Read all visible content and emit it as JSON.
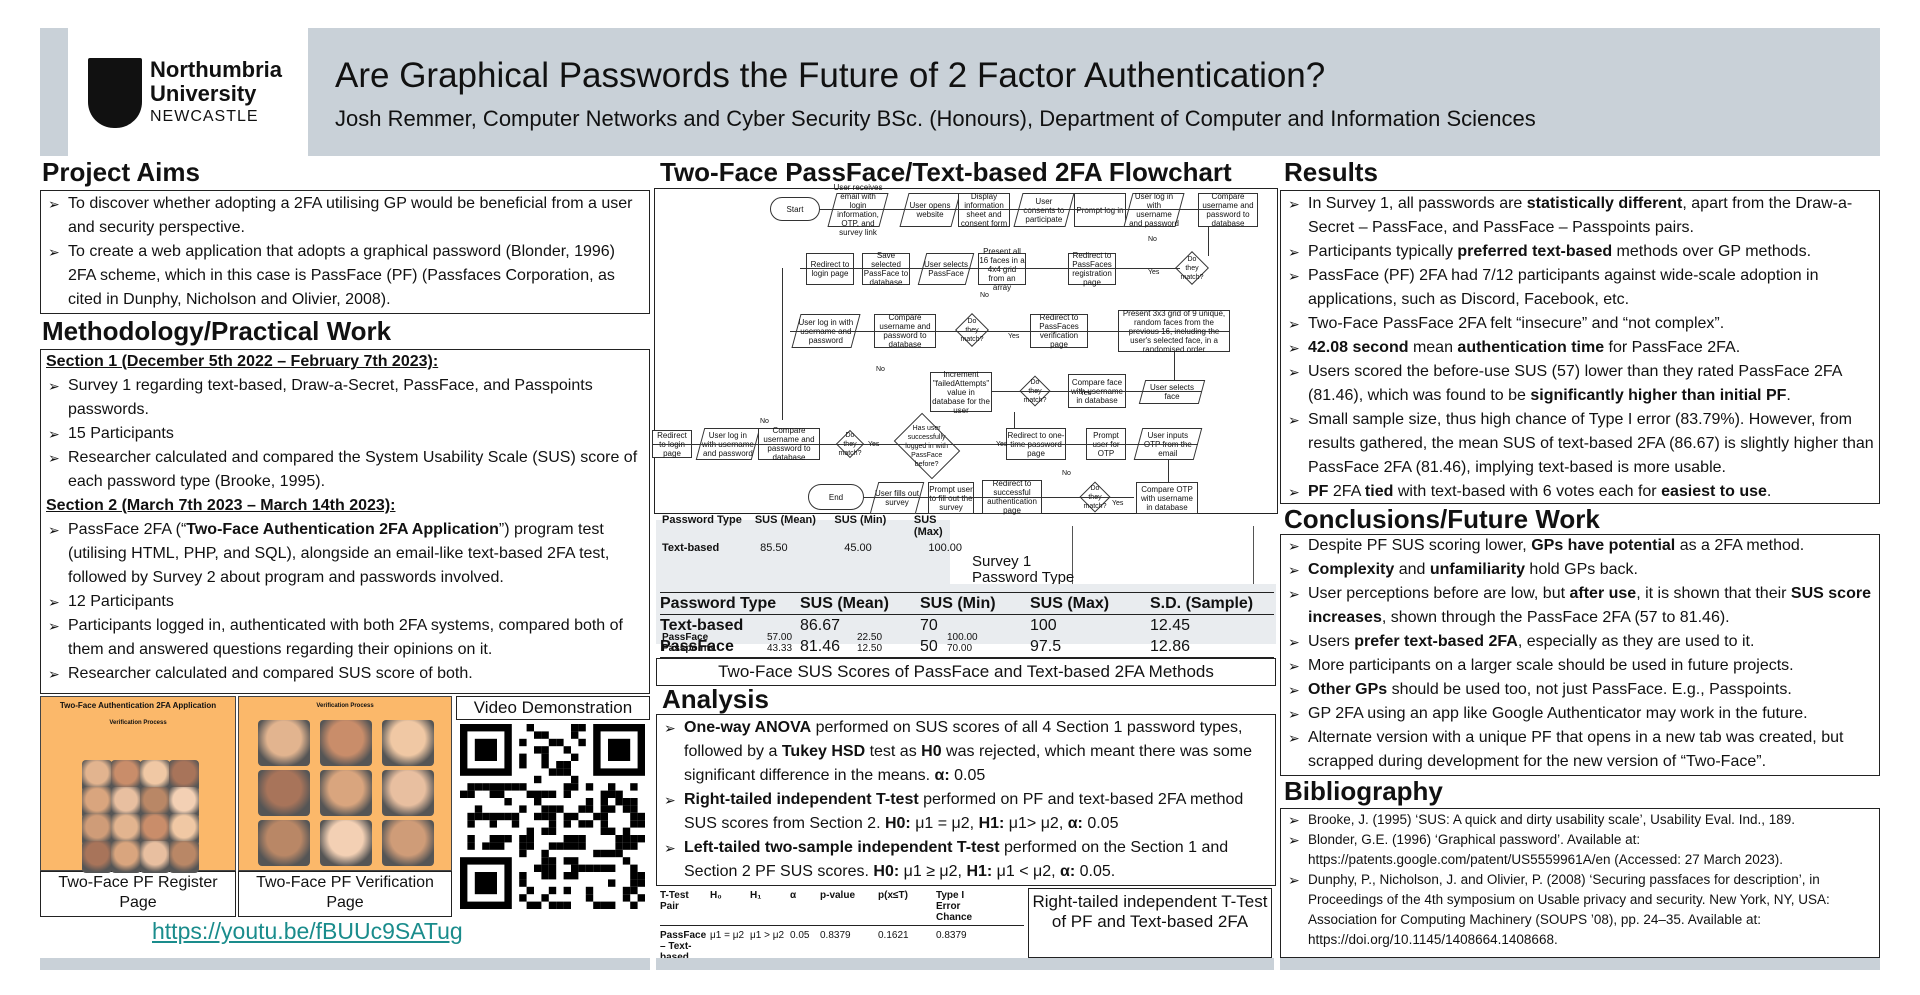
{
  "header": {
    "uni_line1": "Northumbria",
    "uni_line2": "University",
    "uni_line3": "NEWCASTLE",
    "title": "Are Graphical Passwords the Future of 2 Factor Authentication?",
    "subtitle": "Josh Remmer, Computer Networks and Cyber Security BSc. (Honours), Department of Computer and Information Sciences"
  },
  "aims": {
    "heading": "Project Aims",
    "items": [
      "To discover whether adopting a 2FA utilising GP would be beneficial from a user and security perspective.",
      "To create a web application that adopts a graphical password (Blonder, 1996) 2FA scheme, which in this case is PassFace (PF) (Passfaces Corporation, as cited in Dunphy, Nicholson and Olivier, 2008)."
    ]
  },
  "method": {
    "heading": "Methodology/Practical Work",
    "s1_title": "Section 1 (December 5th 2022 – February 7th 2023):",
    "s1_items": [
      "Survey 1 regarding text-based, Draw-a-Secret, PassFace, and Passpoints passwords.",
      "15 Participants",
      "Researcher calculated and compared the System Usability Scale (SUS) score of each password type (Brooke, 1995)."
    ],
    "s2_title": "Section 2 (March 7th 2023 – March 14th 2023):",
    "s2_item1_pre": "PassFace 2FA (“",
    "s2_item1_bold": "Two-Face Authentication 2FA Application",
    "s2_item1_post": "”) program test (utilising HTML, PHP, and SQL), alongside an email-like text-based 2FA test, followed by Survey 2 about program and passwords involved.",
    "s2_items": [
      "12 Participants",
      "Participants logged in, authenticated with both 2FA systems, compared both of them and answered questions regarding their opinions on it.",
      "Researcher calculated and compared SUS score of both."
    ]
  },
  "media": {
    "shot1_title": "Two-Face Authentication 2FA Application",
    "shot1_sub": "Verification Process",
    "shot2_sub": "Verification Process",
    "cap1": "Two-Face PF Register Page",
    "cap2": "Two-Face PF Verification Page",
    "video_label": "Video Demonstration",
    "link": "https://youtu.be/fBUUc9SATug"
  },
  "flow": {
    "heading": "Two-Face PassFace/Text-based 2FA Flowchart",
    "start": "Start",
    "end": "End",
    "r1": [
      "User receives email with login information, OTP, and survey link",
      "User opens website",
      "Display information sheet and consent form",
      "User consents to participate",
      "Prompt log in",
      "User log in with username and password",
      "Compare username and password to database"
    ],
    "r2": [
      "Redirect to login page",
      "Save selected PassFace to database",
      "User selects PassFace",
      "Present all 16 faces in a 4x4 grid from an array",
      "Redirect to PassFaces registration page",
      "Do they match?"
    ],
    "r3": [
      "User log in with username and password",
      "Compare username and password to database",
      "Do they match?",
      "Redirect to PassFaces verification page",
      "Present 3x3 grid of 9 unique, random faces from the previous 16, including the user's selected face, in a randomised order"
    ],
    "r4": [
      "Increment \"failedAttempts\" value in database for the user",
      "Do they match?",
      "Compare face with username in database",
      "User selects face"
    ],
    "r5": [
      "Redirect to login page",
      "User log in with username and password",
      "Compare username and password to database",
      "Do they match?",
      "Has user successfully logged in with PassFace before?",
      "Redirect to one-time password page",
      "Prompt user for OTP",
      "User inputs OTP from the email"
    ],
    "r6": [
      "User fills out survey",
      "Prompt user to fill out the survey",
      "Redirect to successful authentication page",
      "Do they match?",
      "Compare OTP with username in database"
    ],
    "yes": "Yes",
    "no": "No"
  },
  "sus_table": {
    "headers": [
      "Password Type",
      "SUS (Mean)",
      "SUS (Min)",
      "SUS (Max)",
      "S.D. (Sample)"
    ],
    "rows": [
      [
        "Text-based",
        "86.67",
        "70",
        "100",
        "12.45"
      ],
      [
        "PassFace",
        "81.46",
        "50",
        "97.5",
        "12.86"
      ]
    ],
    "caption": "Two-Face SUS Scores of PassFace and Text-based 2FA Methods",
    "overlay_headers": [
      "Password Type",
      "SUS (Mean)",
      "SUS (Min)",
      "SUS (Max)"
    ],
    "overlay_rows": [
      [
        "Text-based",
        "85.50",
        "45.00",
        "100.00"
      ],
      [
        "PassFace",
        "57.00",
        "22.50",
        "100.00"
      ],
      [
        "Passpoints",
        "43.33",
        "12.50",
        "70.00"
      ]
    ],
    "overlay_chart_title": "Survey 1 Password Type SUS Scores"
  },
  "analysis": {
    "heading": "Analysis",
    "i1_b1": "One-way ANOVA",
    "i1_t1": " performed on SUS scores of all 4 Section 1 password types, followed by a ",
    "i1_b2": "Tukey HSD",
    "i1_t2": " test as ",
    "i1_b3": "H0",
    "i1_t3": " was rejected, which meant there was some significant difference in the means. ",
    "i1_b4": "α:",
    "i1_t4": " 0.05",
    "i2_b1": "Right-tailed independent T-test",
    "i2_t1": " performed on PF and text-based 2FA method SUS scores from Section 2. ",
    "i2_b2": "H0:",
    "i2_t2": " μ1 = μ2, ",
    "i2_b3": "H1:",
    "i2_t3": " μ1> μ2, ",
    "i2_b4": "α:",
    "i2_t4": " 0.05",
    "i3_b1": "Left-tailed two-sample independent T-test",
    "i3_t1": " performed on the Section 1 and Section 2 PF SUS scores. ",
    "i3_b2": "H0:",
    "i3_t2": " μ1 ≥ μ2, ",
    "i3_b3": "H1:",
    "i3_t3": " μ1 < μ2, ",
    "i3_b4": "α:",
    "i3_t4": " 0.05.",
    "ttable_headers": [
      "T-Test Pair",
      "H₀",
      "H₁",
      "α",
      "p-value",
      "p(x≤T)",
      "Type I Error Chance"
    ],
    "ttable_row": [
      "PassFace – Text-based",
      "μ1 = μ2",
      "μ1 > μ2",
      "0.05",
      "0.8379",
      "0.1621",
      "0.8379"
    ],
    "ttable_caption": "Right-tailed independent T-Test of PF and Text-based 2FA"
  },
  "results": {
    "heading": "Results"
  },
  "conclusions": {
    "heading": "Conclusions/Future Work"
  },
  "bibliography": {
    "heading": "Bibliography",
    "items": [
      "Brooke, J. (1995) ‘SUS: A quick and dirty usability scale’, Usability Eval. Ind., 189.",
      "Blonder, G.E. (1996) ‘Graphical password’. Available at: https://patents.google.com/patent/US5559961A/en (Accessed: 27 March 2023).",
      "Dunphy, P., Nicholson, J. and Olivier, P. (2008) ‘Securing passfaces for description’, in Proceedings of the 4th symposium on Usable privacy and security. New York, NY, USA: Association for Computing Machinery (SOUPS ’08), pp. 24–35. Available at: https://doi.org/10.1145/1408664.1408668."
    ]
  }
}
